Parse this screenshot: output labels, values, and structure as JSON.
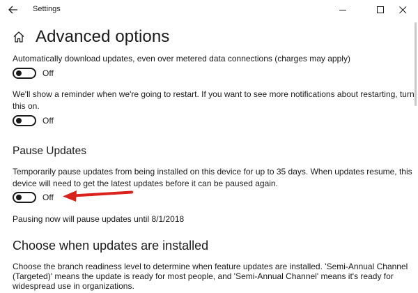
{
  "window": {
    "title": "Settings"
  },
  "header": {
    "page_title": "Advanced options"
  },
  "settings": {
    "metered_download": {
      "label": "Automatically download updates, even over metered data connections (charges may apply)",
      "toggle_state": "Off"
    },
    "restart_reminder": {
      "label_line1": "We'll show a reminder when we're going to restart. If you want to see more notifications about restarting, turn",
      "label_line2": "this on.",
      "toggle_state": "Off"
    }
  },
  "pause_updates": {
    "heading": "Pause Updates",
    "description_line1": "Temporarily pause updates from being installed on this device for up to 35 days. When updates resume, this",
    "description_line2": "device will need to get the latest updates before it can be paused again.",
    "toggle_state": "Off",
    "note": "Pausing now will pause updates until 8/1/2018"
  },
  "choose_when": {
    "heading": "Choose when updates are installed",
    "description_line1": "Choose the branch readiness level to determine when feature updates are installed. 'Semi-Annual Channel",
    "description_line2": "(Targeted)' means the update is ready for most people, and 'Semi-Annual Channel' means it's ready for",
    "description_line3": "widespread use in organizations."
  },
  "colors": {
    "text": "#1a1a1a",
    "background": "#ffffff",
    "annotation_arrow": "#d9221c"
  },
  "icons": {
    "back": "back-arrow-icon",
    "home": "home-icon",
    "minimize": "minimize-icon",
    "maximize": "maximize-icon",
    "close": "close-icon",
    "annotation": "red-arrow-icon"
  }
}
